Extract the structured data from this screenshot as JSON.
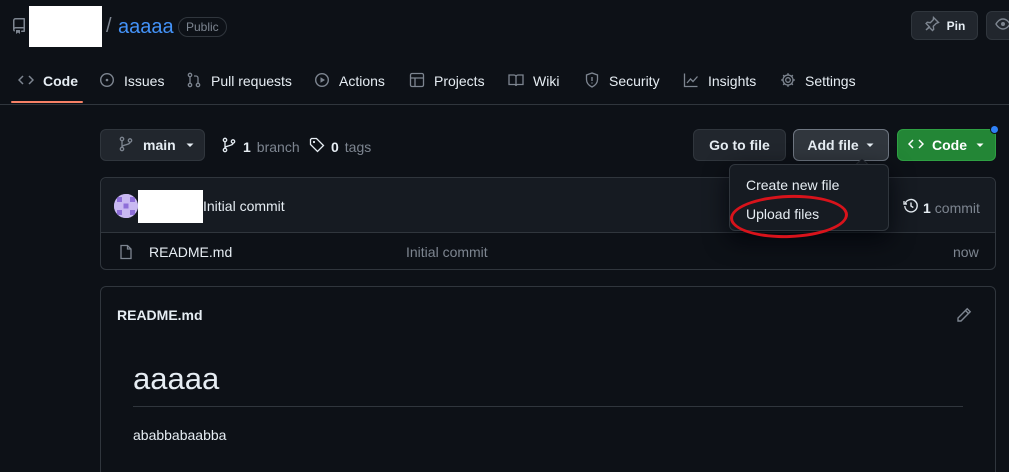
{
  "repo": {
    "name": "aaaaa",
    "separator": "/",
    "visibility": "Public",
    "pin_label": "Pin"
  },
  "nav": {
    "items": [
      {
        "label": "Code",
        "icon": "code-icon"
      },
      {
        "label": "Issues",
        "icon": "issue-opened-icon"
      },
      {
        "label": "Pull requests",
        "icon": "git-pull-request-icon"
      },
      {
        "label": "Actions",
        "icon": "play-icon"
      },
      {
        "label": "Projects",
        "icon": "table-icon"
      },
      {
        "label": "Wiki",
        "icon": "book-icon"
      },
      {
        "label": "Security",
        "icon": "shield-icon"
      },
      {
        "label": "Insights",
        "icon": "graph-icon"
      },
      {
        "label": "Settings",
        "icon": "gear-icon"
      }
    ],
    "active": "Code"
  },
  "toolbar": {
    "branch": "main",
    "branch_count": "1",
    "branch_label": "branch",
    "tag_count": "0",
    "tag_label": "tags",
    "goto_file": "Go to file",
    "add_file": "Add file",
    "code": "Code"
  },
  "add_file_menu": {
    "items": [
      "Create new file",
      "Upload files"
    ],
    "highlighted": "Upload files"
  },
  "commit": {
    "message": "Initial commit",
    "count": "1",
    "count_label": "commit"
  },
  "files": [
    {
      "name": "README.md",
      "commit": "Initial commit",
      "time": "now"
    }
  ],
  "readme": {
    "title": "README.md",
    "heading": "aaaaa",
    "body": "ababbabaabba"
  },
  "colors": {
    "background": "#0d1117",
    "link": "#4493f8",
    "primary_button": "#238636",
    "active_tab_underline": "#f78166",
    "highlight": "#d8131b"
  }
}
